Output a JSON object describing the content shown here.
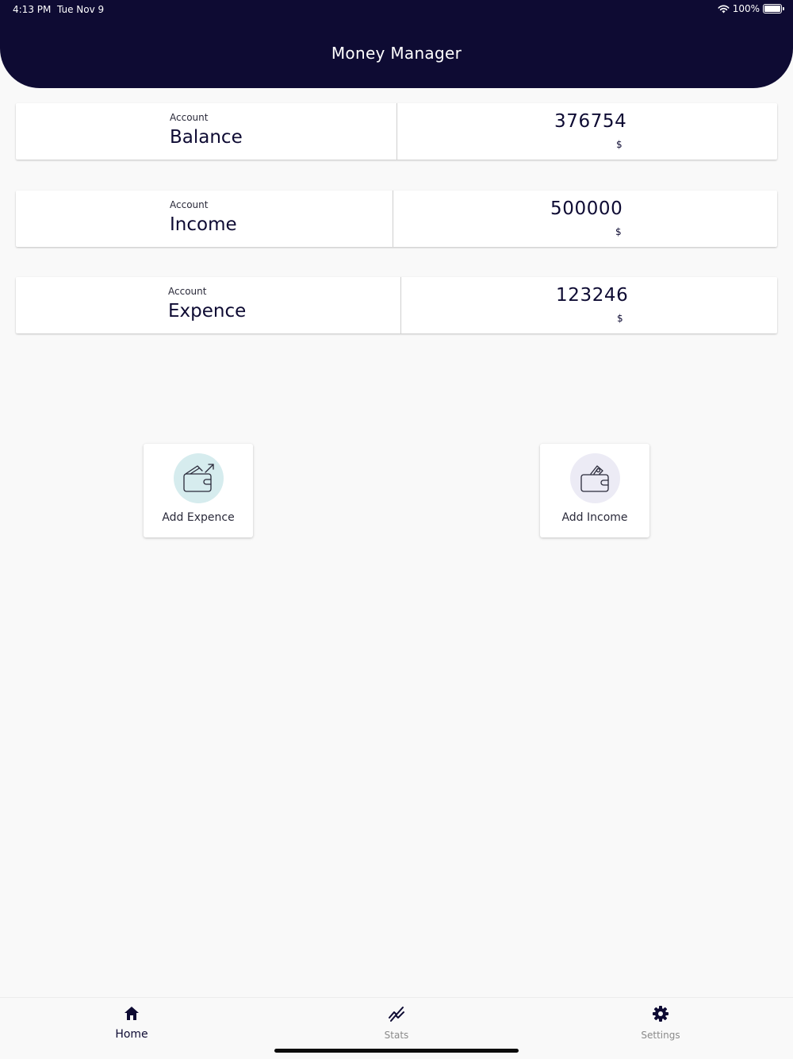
{
  "status_bar": {
    "time": "4:13 PM",
    "date": "Tue Nov 9",
    "battery": "100%"
  },
  "header": {
    "title": "Money Manager"
  },
  "accounts": [
    {
      "caption": "Account",
      "label": "Balance",
      "amount": "376754",
      "currency": "$"
    },
    {
      "caption": "Account",
      "label": "Income",
      "amount": "500000",
      "currency": "$"
    },
    {
      "caption": "Account",
      "label": "Expence",
      "amount": "123246",
      "currency": "$"
    }
  ],
  "actions": {
    "add_expence": {
      "label": "Add Expence",
      "icon": "wallet-expense-icon",
      "circle_color": "#d6ecee"
    },
    "add_income": {
      "label": "Add Income",
      "icon": "wallet-income-icon",
      "circle_color": "#ecebf5"
    }
  },
  "bottom_nav": {
    "home": {
      "label": "Home",
      "icon": "home-icon"
    },
    "stats": {
      "label": "Stats",
      "icon": "stats-icon"
    },
    "settings": {
      "label": "Settings",
      "icon": "gear-icon"
    }
  },
  "colors": {
    "primary": "#0e0b33",
    "background": "#f9f9f9",
    "inactive": "#8a8a8a"
  }
}
